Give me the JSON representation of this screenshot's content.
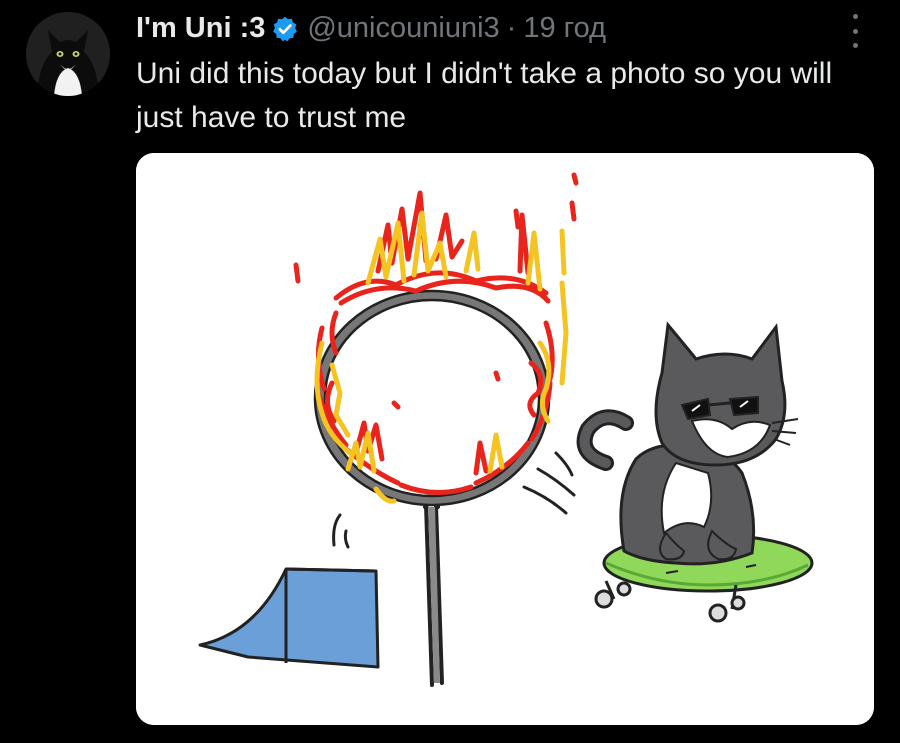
{
  "tweet": {
    "author": {
      "display_name": "I'm Uni :3",
      "handle": "@unicouniuni3",
      "verified": true,
      "avatar_icon": "cat-avatar-icon",
      "verified_icon": "verified-badge-icon"
    },
    "separator": "·",
    "timestamp": "19 год",
    "more_icon": "more-options-icon",
    "text": "Uni did this today but I didn't take a photo so you will just have to trust me",
    "media": {
      "type": "drawing",
      "description_icon": "cat-jumping-through-fire-hoop-drawing"
    }
  },
  "colors": {
    "background": "#000000",
    "primary_text": "#e7e9ea",
    "secondary_text": "#71767b",
    "verified_blue": "#1d9bf0",
    "media_background": "#ffffff",
    "flame_red": "#e8241c",
    "flame_yellow": "#f5c423",
    "ramp_blue": "#6a9fd8",
    "skateboard_green": "#8fd85a",
    "cat_gray": "#5a5a5c"
  }
}
